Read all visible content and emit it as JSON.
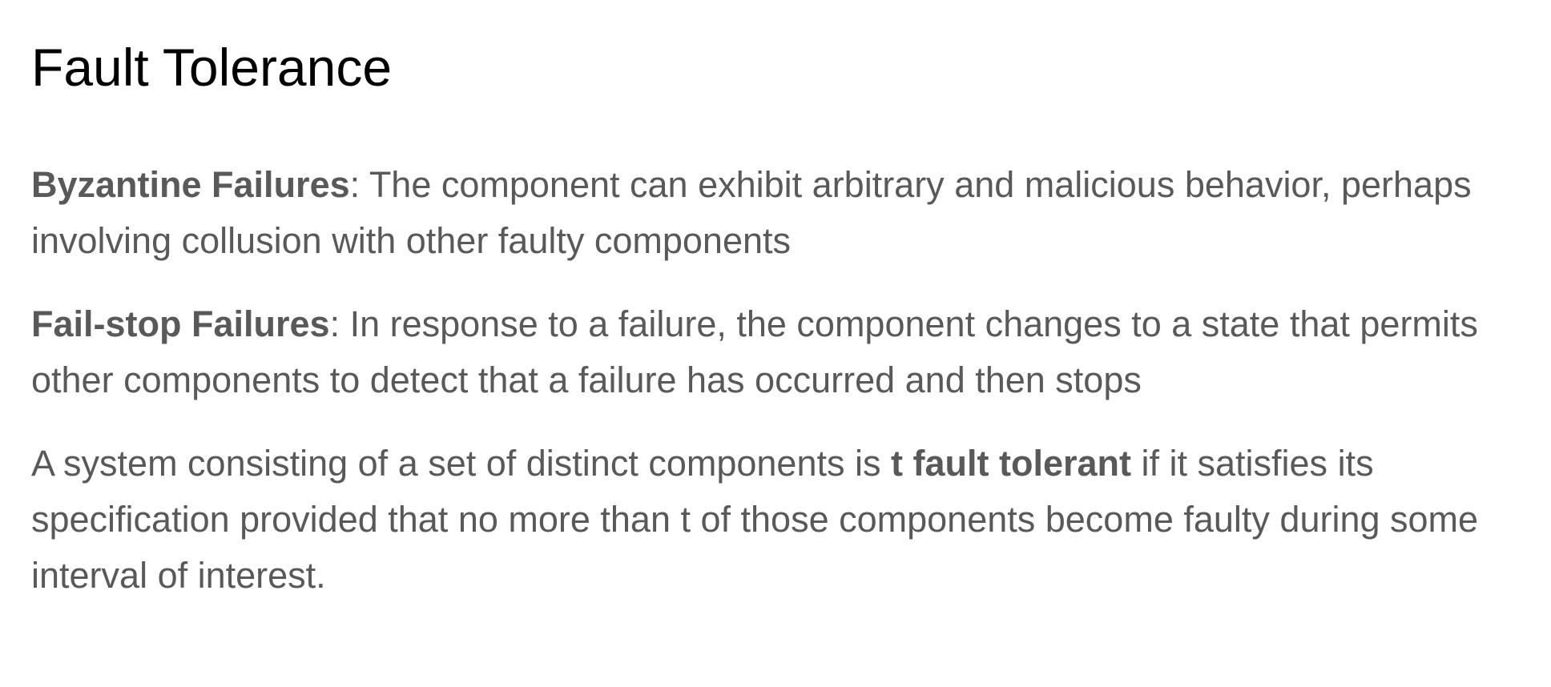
{
  "slide": {
    "title": "Fault Tolerance",
    "paragraphs": [
      {
        "term": "Byzantine Failures",
        "text": ": The component can exhibit arbitrary and malicious behavior, perhaps involving collusion with other faulty components"
      },
      {
        "term": "Fail-stop Failures",
        "text": ": In response to a failure, the component changes to a state that permits other components to detect that a failure has occurred and then stops"
      },
      {
        "before": "A system consisting of a set of distinct components is ",
        "term": "t fault tolerant",
        "after": " if it satisfies its specification provided that no more than t of those components become faulty during some interval of interest."
      }
    ]
  }
}
